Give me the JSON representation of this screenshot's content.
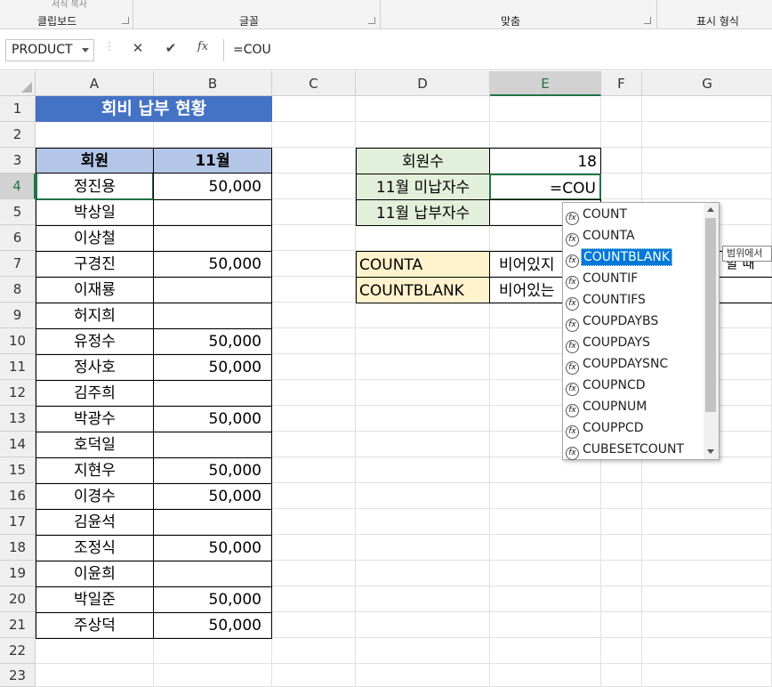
{
  "ribbon": {
    "groups": [
      "클립보드",
      "글꼴",
      "맞춤",
      "표시 형식"
    ],
    "top_cut_text": "서식 복사"
  },
  "formula_bar": {
    "name_box": "PRODUCT",
    "cancel": "✕",
    "enter": "✔",
    "fx": "fx",
    "formula": "=COU"
  },
  "columns": [
    "A",
    "B",
    "C",
    "D",
    "E",
    "F",
    "G"
  ],
  "selected_column": "E",
  "rows": [
    "1",
    "2",
    "3",
    "4",
    "5",
    "6",
    "7",
    "8",
    "9",
    "10",
    "11",
    "12",
    "13",
    "14",
    "15",
    "16",
    "17",
    "18",
    "19",
    "20",
    "21",
    "22",
    "23"
  ],
  "selected_row": "4",
  "sheet": {
    "title": "회비 납부 현황",
    "header_member": "회원",
    "header_month": "11월",
    "members": [
      {
        "name": "정진용",
        "paid": "50,000"
      },
      {
        "name": "박상일",
        "paid": ""
      },
      {
        "name": "이상철",
        "paid": ""
      },
      {
        "name": "구경진",
        "paid": "50,000"
      },
      {
        "name": "이재룡",
        "paid": ""
      },
      {
        "name": "허지희",
        "paid": ""
      },
      {
        "name": "유정수",
        "paid": "50,000"
      },
      {
        "name": "정사호",
        "paid": "50,000"
      },
      {
        "name": "김주희",
        "paid": ""
      },
      {
        "name": "박광수",
        "paid": "50,000"
      },
      {
        "name": "호덕일",
        "paid": ""
      },
      {
        "name": "지현우",
        "paid": "50,000"
      },
      {
        "name": "이경수",
        "paid": "50,000"
      },
      {
        "name": "김윤석",
        "paid": ""
      },
      {
        "name": "조정식",
        "paid": "50,000"
      },
      {
        "name": "이윤희",
        "paid": ""
      },
      {
        "name": "박일준",
        "paid": "50,000"
      },
      {
        "name": "주상덕",
        "paid": "50,000"
      }
    ],
    "summary": [
      {
        "label": "회원수",
        "value": "18"
      },
      {
        "label": "11월 미납자수",
        "value": "=COU"
      },
      {
        "label": "11월 납부자수",
        "value": ""
      }
    ],
    "notes": [
      {
        "func": "COUNTA",
        "desc": "비어있지"
      },
      {
        "func": "COUNTBLANK",
        "desc": "비어있는"
      }
    ],
    "note_right_fragment": "할 때"
  },
  "autocomplete": {
    "items": [
      "COUNT",
      "COUNTA",
      "COUNTBLANK",
      "COUNTIF",
      "COUNTIFS",
      "COUPDAYBS",
      "COUPDAYS",
      "COUPDAYSNC",
      "COUPNCD",
      "COUPNUM",
      "COUPPCD",
      "CUBESETCOUNT"
    ],
    "highlighted": "COUNTBLANK",
    "tooltip": "범위에서"
  },
  "colors": {
    "title_fill": "#4472c4",
    "header_fill": "#b4c6e7",
    "summary_fill": "#e2efda",
    "note_fill": "#fff2cc",
    "accent": "#217346",
    "highlight": "#0078d7"
  }
}
